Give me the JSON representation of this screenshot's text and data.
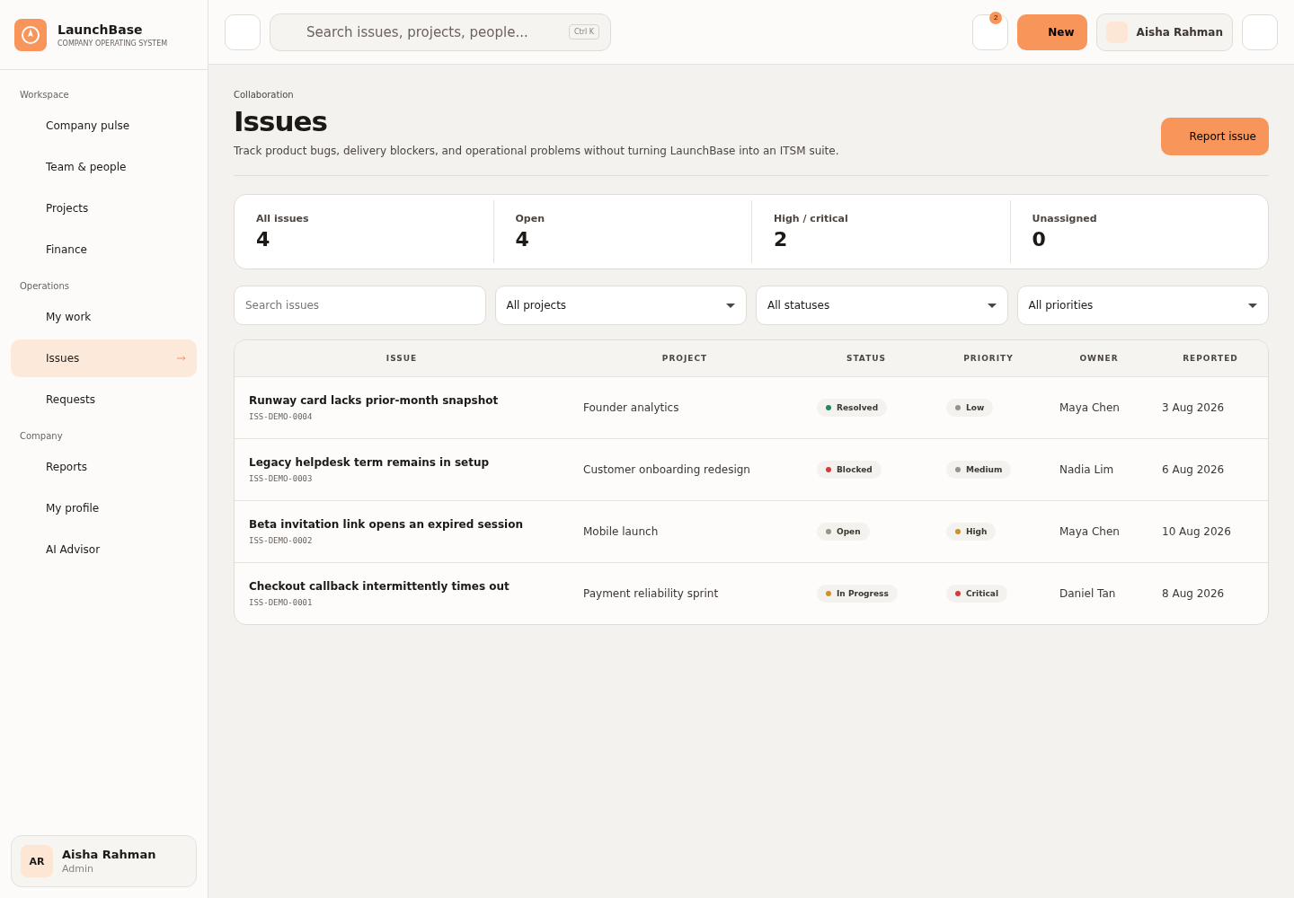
{
  "brand": {
    "name": "LaunchBase",
    "tagline": "COMPANY OPERATING SYSTEM"
  },
  "sidebar": {
    "sections": [
      {
        "title": "Workspace",
        "items": [
          {
            "label": "Company pulse",
            "selected": false
          },
          {
            "label": "Team & people",
            "selected": false
          },
          {
            "label": "Projects",
            "selected": false
          },
          {
            "label": "Finance",
            "selected": false
          }
        ]
      },
      {
        "title": "Operations",
        "items": [
          {
            "label": "My work",
            "selected": false
          },
          {
            "label": "Issues",
            "selected": true
          },
          {
            "label": "Requests",
            "selected": false
          }
        ]
      },
      {
        "title": "Company",
        "items": [
          {
            "label": "Reports",
            "selected": false
          },
          {
            "label": "My profile",
            "selected": false
          },
          {
            "label": "AI Advisor",
            "selected": false
          }
        ]
      }
    ],
    "user": {
      "initials": "AR",
      "name": "Aisha Rahman",
      "role": "Admin"
    }
  },
  "topbar": {
    "search": {
      "placeholder": "Search issues, projects, people...",
      "shortcut": "Ctrl K"
    },
    "notification_count": "2",
    "new_button": "New",
    "user_name": "Aisha Rahman"
  },
  "page": {
    "breadcrumb": "Collaboration",
    "title": "Issues",
    "description": "Track product bugs, delivery blockers, and operational problems without turning LaunchBase into an ITSM suite.",
    "action": "Report issue"
  },
  "stats": [
    {
      "label": "All issues",
      "value": "4"
    },
    {
      "label": "Open",
      "value": "4"
    },
    {
      "label": "High / critical",
      "value": "2"
    },
    {
      "label": "Unassigned",
      "value": "0"
    }
  ],
  "filters": {
    "search": {
      "placeholder": "Search issues"
    },
    "selects": [
      "All projects",
      "All statuses",
      "All priorities"
    ]
  },
  "table": {
    "columns": [
      "ISSUE",
      "PROJECT",
      "STATUS",
      "PRIORITY",
      "OWNER",
      "REPORTED"
    ],
    "rows": [
      {
        "title": "Runway card lacks prior-month snapshot",
        "id": "ISS-DEMO-0004",
        "project": "Founder analytics",
        "status": {
          "label": "Resolved",
          "color": "#1f8a5b"
        },
        "priority": {
          "label": "Low",
          "color": "#9a918b"
        },
        "owner": "Maya Chen",
        "reported": "3 Aug 2026"
      },
      {
        "title": "Legacy helpdesk term remains in setup",
        "id": "ISS-DEMO-0003",
        "project": "Customer onboarding redesign",
        "status": {
          "label": "Blocked",
          "color": "#d63b3b"
        },
        "priority": {
          "label": "Medium",
          "color": "#9a918b"
        },
        "owner": "Nadia Lim",
        "reported": "6 Aug 2026"
      },
      {
        "title": "Beta invitation link opens an expired session",
        "id": "ISS-DEMO-0002",
        "project": "Mobile launch",
        "status": {
          "label": "Open",
          "color": "#9a918b"
        },
        "priority": {
          "label": "High",
          "color": "#d0902a"
        },
        "owner": "Maya Chen",
        "reported": "10 Aug 2026"
      },
      {
        "title": "Checkout callback intermittently times out",
        "id": "ISS-DEMO-0001",
        "project": "Payment reliability sprint",
        "status": {
          "label": "In Progress",
          "color": "#d0902a"
        },
        "priority": {
          "label": "Critical",
          "color": "#d63b3b"
        },
        "owner": "Daniel Tan",
        "reported": "8 Aug 2026"
      }
    ]
  }
}
